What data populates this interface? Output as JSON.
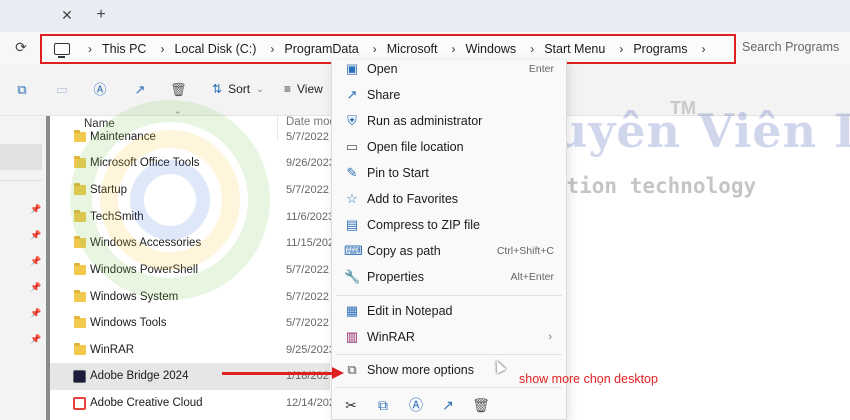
{
  "addressbar": {
    "crumbs": [
      "This PC",
      "Local Disk (C:)",
      "ProgramData",
      "Microsoft",
      "Windows",
      "Start Menu",
      "Programs"
    ],
    "search_placeholder": "Search Programs"
  },
  "toolbar": {
    "sort_label": "Sort",
    "view_label": "View"
  },
  "filelist": {
    "col_name": "Name",
    "col_date": "Date modi",
    "rows": [
      {
        "name": "Maintenance",
        "date": "5/7/2022 1",
        "icon": "folder"
      },
      {
        "name": "Microsoft Office Tools",
        "date": "9/26/2023",
        "icon": "folder"
      },
      {
        "name": "Startup",
        "date": "5/7/2022 1",
        "icon": "folder"
      },
      {
        "name": "TechSmith",
        "date": "11/6/2023",
        "icon": "folder"
      },
      {
        "name": "Windows Accessories",
        "date": "11/15/202",
        "icon": "folder"
      },
      {
        "name": "Windows PowerShell",
        "date": "5/7/2022 2",
        "icon": "folder"
      },
      {
        "name": "Windows System",
        "date": "5/7/2022 1",
        "icon": "folder"
      },
      {
        "name": "Windows Tools",
        "date": "5/7/2022 2",
        "icon": "folder"
      },
      {
        "name": "WinRAR",
        "date": "9/25/2023",
        "icon": "folder"
      },
      {
        "name": "Adobe Bridge 2024",
        "date": "1/18/202",
        "icon": "adobe-bridge"
      },
      {
        "name": "Adobe Creative Cloud",
        "date": "12/14/202",
        "icon": "creative-cloud"
      }
    ]
  },
  "context_menu": {
    "items": [
      {
        "label": "Open",
        "shortcut": "Enter",
        "icon": "open-icon"
      },
      {
        "label": "Share",
        "shortcut": "",
        "icon": "share-icon"
      },
      {
        "label": "Run as administrator",
        "shortcut": "",
        "icon": "shield-icon"
      },
      {
        "label": "Open file location",
        "shortcut": "",
        "icon": "folder-icon"
      },
      {
        "label": "Pin to Start",
        "shortcut": "",
        "icon": "pin-icon"
      },
      {
        "label": "Add to Favorites",
        "shortcut": "",
        "icon": "star-icon"
      },
      {
        "label": "Compress to ZIP file",
        "shortcut": "",
        "icon": "zip-icon"
      },
      {
        "label": "Copy as path",
        "shortcut": "Ctrl+Shift+C",
        "icon": "copy-path-icon"
      },
      {
        "label": "Properties",
        "shortcut": "Alt+Enter",
        "icon": "wrench-icon"
      },
      {
        "label": "Edit in Notepad",
        "shortcut": "",
        "icon": "notepad-icon"
      },
      {
        "label": "WinRAR",
        "shortcut": "",
        "icon": "winrar-icon"
      },
      {
        "label": "Show more options",
        "shortcut": "",
        "icon": "more-options-icon"
      }
    ]
  },
  "watermark": {
    "title": "Chuyên Viên IT",
    "tm": "TM",
    "subtitle": "information technology"
  },
  "annotation": {
    "text": "show more chọn desktop",
    "color": "#e02020"
  },
  "colors": {
    "accent": "#2c6fb7",
    "highlight": "#e02020",
    "folder": "#f2c94c"
  }
}
